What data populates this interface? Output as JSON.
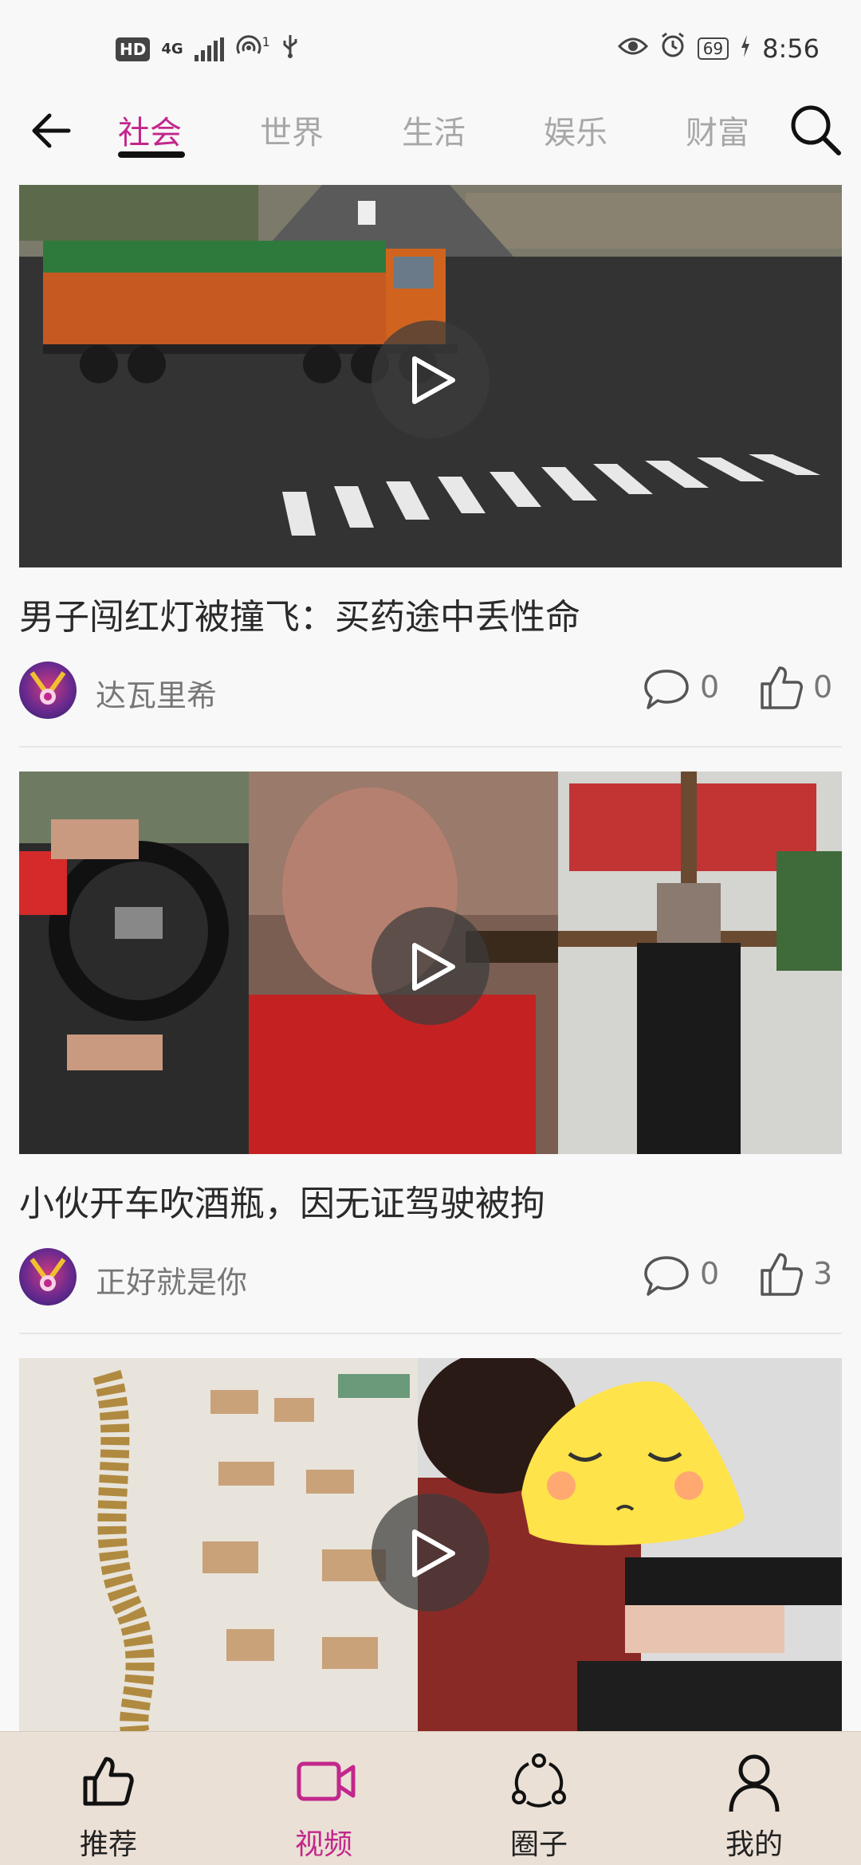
{
  "status_bar": {
    "hd": "HD",
    "network": "4G",
    "hotspot_sup": "1",
    "battery": "69",
    "time": "8:56"
  },
  "nav": {
    "tabs": [
      "社会",
      "世界",
      "生活",
      "娱乐",
      "财富"
    ],
    "active_tab": "社会"
  },
  "feed": [
    {
      "title": "男子闯红灯被撞飞：买药途中丢性命",
      "author": "达瓦里希",
      "comments": "0",
      "likes": "0"
    },
    {
      "title": "小伙开车吹酒瓶，因无证驾驶被拘",
      "author": "正好就是你",
      "comments": "0",
      "likes": "3"
    },
    {
      "title": "",
      "author": "",
      "comments": "",
      "likes": ""
    }
  ],
  "bottom_nav": {
    "items": [
      "推荐",
      "视频",
      "圈子",
      "我的"
    ],
    "active": "视频"
  },
  "colors": {
    "accent": "#c2278b",
    "bottom_bar": "#ebe0d6",
    "background": "#f8f8f8"
  },
  "icons": [
    "back-arrow-icon",
    "search-icon",
    "play-icon",
    "comment-icon",
    "thumbs-up-icon",
    "video-camera-icon",
    "circle-group-icon",
    "person-icon"
  ]
}
